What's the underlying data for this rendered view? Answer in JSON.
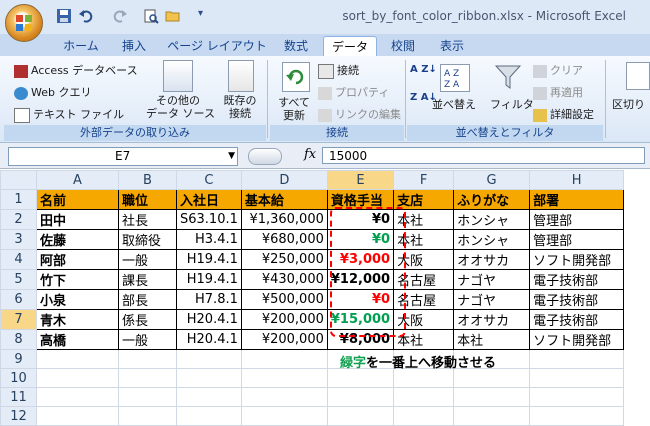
{
  "window": {
    "title": "sort_by_font_color_ribbon.xlsx - Microsoft Excel"
  },
  "tabs": [
    "ホーム",
    "挿入",
    "ページ レイアウト",
    "数式",
    "データ",
    "校閲",
    "表示"
  ],
  "active_tab": "データ",
  "ribbon": {
    "external": {
      "access": "Access データベース",
      "web": "Web クエリ",
      "text": "テキスト ファイル",
      "other_1": "その他の",
      "other_2": "データ ソース",
      "existing_1": "既存の",
      "existing_2": "接続",
      "group": "外部データの取り込み"
    },
    "connections": {
      "refresh_1": "すべて",
      "refresh_2": "更新",
      "connect": "接続",
      "properties": "プロパティ",
      "edit_links": "リンクの編集",
      "group": "接続"
    },
    "sort_filter": {
      "sort": "並べ替え",
      "filter": "フィルタ",
      "clear": "クリア",
      "reapply": "再適用",
      "advanced": "詳細設定",
      "group": "並べ替えとフィルタ",
      "az": "A Z",
      "za": "Z A"
    },
    "cut": "区切り"
  },
  "formula_bar": {
    "name_box": "E7",
    "fx": "fx",
    "value": "15000"
  },
  "sheet": {
    "columns": [
      "A",
      "B",
      "C",
      "D",
      "E",
      "F",
      "G",
      "H"
    ],
    "row_numbers": [
      "1",
      "2",
      "3",
      "4",
      "5",
      "6",
      "7",
      "8",
      "9",
      "10",
      "11",
      "12"
    ],
    "header": [
      "名前",
      "職位",
      "入社日",
      "基本給",
      "資格手当",
      "支店",
      "ふりがな",
      "部署"
    ],
    "rows": [
      [
        "田中",
        "社長",
        "S63.10.1",
        "¥1,360,000",
        "¥0",
        "本社",
        "ホンシャ",
        "管理部"
      ],
      [
        "佐藤",
        "取締役",
        "H3.4.1",
        "¥680,000",
        "¥0",
        "本社",
        "ホンシャ",
        "管理部"
      ],
      [
        "阿部",
        "一般",
        "H19.4.1",
        "¥250,000",
        "¥3,000",
        "大阪",
        "オオサカ",
        "ソフト開発部"
      ],
      [
        "竹下",
        "課長",
        "H19.4.1",
        "¥430,000",
        "¥12,000",
        "名古屋",
        "ナゴヤ",
        "電子技術部"
      ],
      [
        "小泉",
        "部長",
        "H7.8.1",
        "¥500,000",
        "¥0",
        "名古屋",
        "ナゴヤ",
        "電子技術部"
      ],
      [
        "青木",
        "係長",
        "H20.4.1",
        "¥200,000",
        "¥15,000",
        "大阪",
        "オオサカ",
        "電子技術部"
      ],
      [
        "高橋",
        "一般",
        "H20.4.1",
        "¥200,000",
        "¥8,000",
        "本社",
        "本社",
        "ソフト開発部"
      ]
    ],
    "allowance_colors": [
      "#000000",
      "#00a050",
      "#ff0000",
      "#000000",
      "#ff0000",
      "#00a050",
      "#000000"
    ]
  },
  "note": {
    "green_part": "緑字",
    "rest": "を一番上へ移動させる"
  },
  "colors": {
    "header_fill": "#f6a800",
    "accent_green": "#00a050",
    "accent_red": "#ff0000"
  }
}
